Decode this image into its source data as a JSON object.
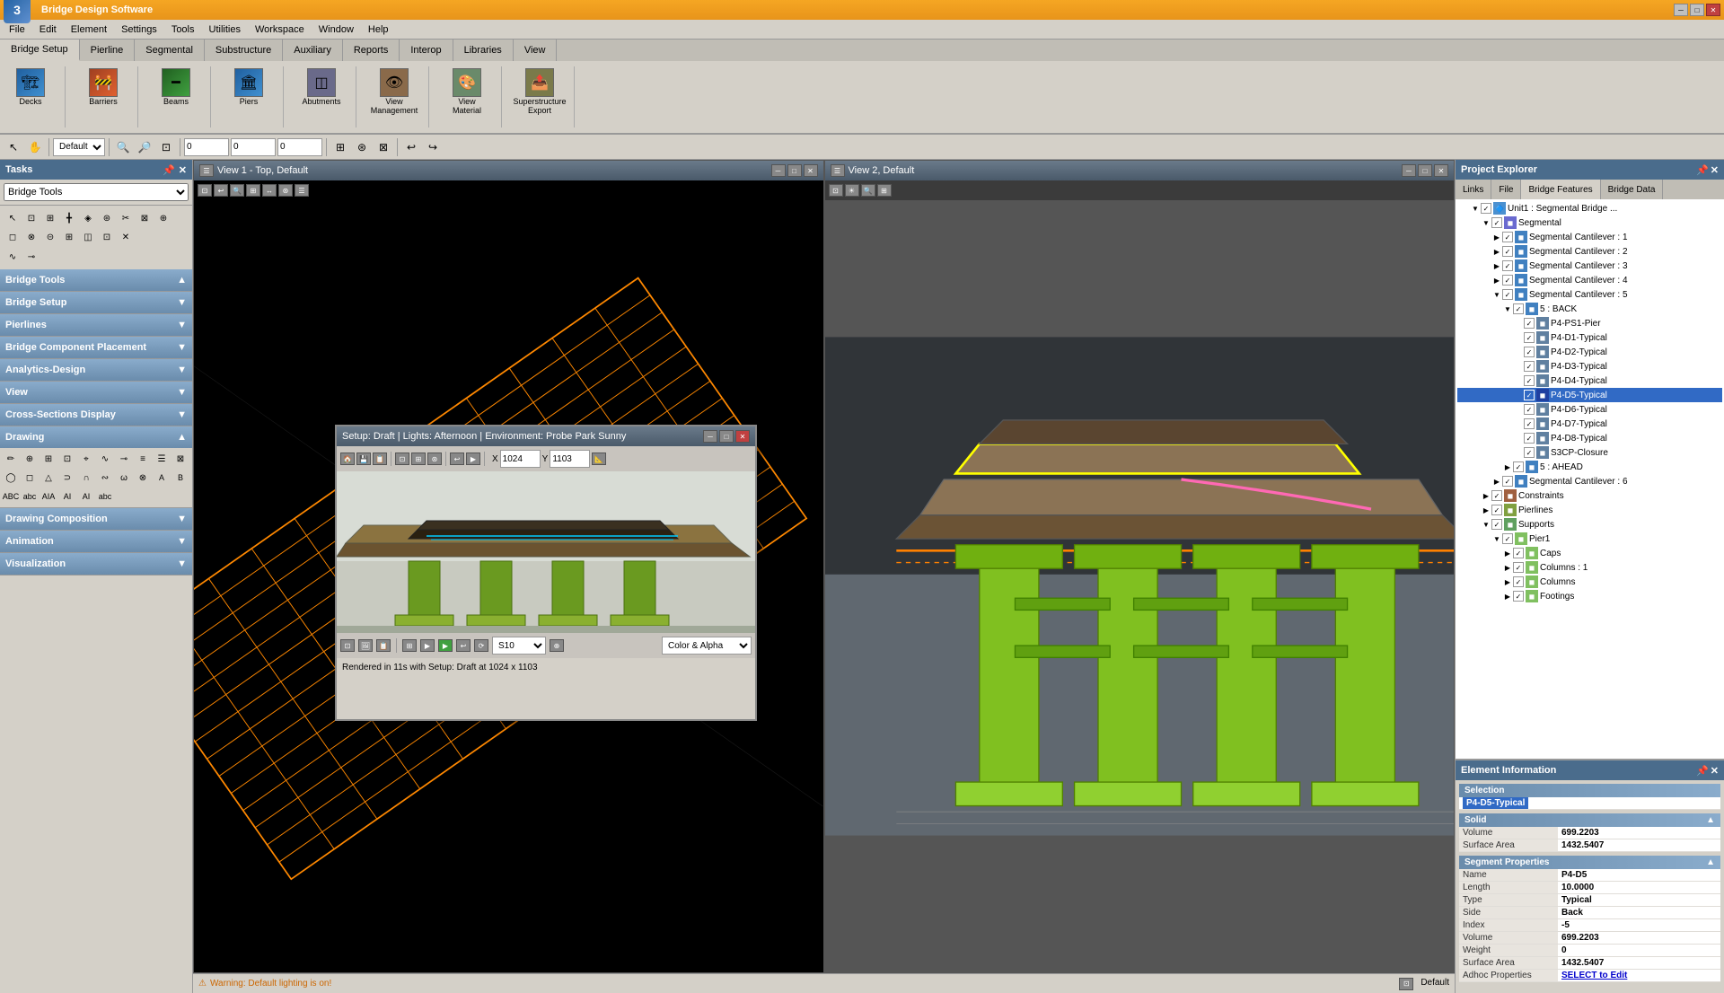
{
  "app": {
    "title": "Bridge Design Software",
    "logo": "3"
  },
  "title_bar": {
    "title": "Bridge Design",
    "minimize": "─",
    "maximize": "□",
    "close": "✕"
  },
  "menu": {
    "items": [
      "File",
      "Edit",
      "Element",
      "Settings",
      "Tools",
      "Utilities",
      "Workspace",
      "Window",
      "Help"
    ]
  },
  "ribbon": {
    "tabs": [
      "Bridge Setup",
      "Pierline",
      "Segmental",
      "Substructure",
      "Auxiliary",
      "Reports",
      "Interop",
      "Libraries",
      "View"
    ],
    "active_tab": "Bridge Setup",
    "groups": [
      {
        "name": "Decks",
        "icon": "🏗️"
      },
      {
        "name": "Barriers",
        "icon": "🚧"
      },
      {
        "name": "Beams",
        "icon": "━"
      },
      {
        "name": "Piers",
        "icon": "🏛️"
      },
      {
        "name": "Abutments",
        "icon": "◫"
      },
      {
        "name": "View Management",
        "icon": "👁️"
      },
      {
        "name": "View Material",
        "icon": "🎨"
      },
      {
        "name": "Superstructure Export",
        "icon": "📤"
      }
    ]
  },
  "tasks": {
    "title": "Tasks",
    "dropdown": "Bridge Tools",
    "sections": [
      {
        "name": "Bridge Tools",
        "expanded": true
      },
      {
        "name": "Bridge Setup",
        "expanded": false
      },
      {
        "name": "Pierlines",
        "expanded": false
      },
      {
        "name": "Bridge Component Placement",
        "expanded": false
      },
      {
        "name": "Analytics-Design",
        "expanded": false
      },
      {
        "name": "View",
        "expanded": false
      },
      {
        "name": "Cross-Sections Display",
        "expanded": false
      },
      {
        "name": "Drawing",
        "expanded": true
      }
    ],
    "sub_sections": [
      {
        "name": "Drawing Composition",
        "expanded": false
      },
      {
        "name": "Animation",
        "expanded": false
      },
      {
        "name": "Visualization",
        "expanded": false
      }
    ]
  },
  "viewports": [
    {
      "id": "view1",
      "title": "View 1 - Top, Default"
    },
    {
      "id": "view2",
      "title": "View 2, Default"
    }
  ],
  "render_window": {
    "title": "Setup: Draft | Lights: Afternoon | Environment: Probe Park Sunny",
    "coords": {
      "x_label": "X",
      "x_value": "1024",
      "y_label": "Y",
      "y_value": "1103"
    },
    "color_mode": "Color & Alpha",
    "status": "Rendered in 11s with Setup: Draft at 1024 x 1103"
  },
  "project_explorer": {
    "title": "Project Explorer",
    "tabs": [
      "Links",
      "File",
      "Bridge Features",
      "Bridge Data"
    ],
    "active_tab": "Bridge Features",
    "tree": [
      {
        "level": 0,
        "label": "Unit1 : Segmental Bridge ...",
        "expanded": true,
        "checked": true
      },
      {
        "level": 1,
        "label": "Segmental",
        "expanded": true,
        "checked": true
      },
      {
        "level": 2,
        "label": "Segmental Cantilever : 1",
        "expanded": false,
        "checked": true
      },
      {
        "level": 2,
        "label": "Segmental Cantilever : 2",
        "expanded": false,
        "checked": true
      },
      {
        "level": 2,
        "label": "Segmental Cantilever : 3",
        "expanded": false,
        "checked": true
      },
      {
        "level": 2,
        "label": "Segmental Cantilever : 4",
        "expanded": false,
        "checked": true
      },
      {
        "level": 2,
        "label": "Segmental Cantilever : 5",
        "expanded": true,
        "checked": true
      },
      {
        "level": 3,
        "label": "5 : BACK",
        "expanded": true,
        "checked": true
      },
      {
        "level": 4,
        "label": "P4-PS1-Pier",
        "expanded": false,
        "checked": true
      },
      {
        "level": 4,
        "label": "P4-D1-Typical",
        "expanded": false,
        "checked": true
      },
      {
        "level": 4,
        "label": "P4-D2-Typical",
        "expanded": false,
        "checked": true
      },
      {
        "level": 4,
        "label": "P4-D3-Typical",
        "expanded": false,
        "checked": true
      },
      {
        "level": 4,
        "label": "P4-D4-Typical",
        "expanded": false,
        "checked": true
      },
      {
        "level": 4,
        "label": "P4-D5-Typical",
        "expanded": false,
        "checked": true,
        "selected": true
      },
      {
        "level": 4,
        "label": "P4-D6-Typical",
        "expanded": false,
        "checked": true
      },
      {
        "level": 4,
        "label": "P4-D7-Typical",
        "expanded": false,
        "checked": true
      },
      {
        "level": 4,
        "label": "P4-D8-Typical",
        "expanded": false,
        "checked": true
      },
      {
        "level": 4,
        "label": "S3CP-Closure",
        "expanded": false,
        "checked": true
      },
      {
        "level": 3,
        "label": "5 : AHEAD",
        "expanded": false,
        "checked": true
      },
      {
        "level": 2,
        "label": "Segmental Cantilever : 6",
        "expanded": false,
        "checked": true
      },
      {
        "level": 1,
        "label": "Constraints",
        "expanded": false,
        "checked": true
      },
      {
        "level": 1,
        "label": "Pierlines",
        "expanded": false,
        "checked": true
      },
      {
        "level": 1,
        "label": "Supports",
        "expanded": true,
        "checked": true
      },
      {
        "level": 2,
        "label": "Pier1",
        "expanded": true,
        "checked": true
      },
      {
        "level": 3,
        "label": "Caps",
        "expanded": false,
        "checked": true
      },
      {
        "level": 3,
        "label": "Columns : 1",
        "expanded": false,
        "checked": true
      },
      {
        "level": 3,
        "label": "Columns",
        "expanded": false,
        "checked": true
      },
      {
        "level": 3,
        "label": "Footings",
        "expanded": false,
        "checked": true
      }
    ]
  },
  "element_info": {
    "title": "Element Information",
    "selection_label": "Selection",
    "selected_item": "P4-D5-Typical",
    "solid": {
      "label": "Solid",
      "volume_label": "Volume",
      "volume_value": "699.2203",
      "surface_area_label": "Surface Area",
      "surface_area_value": "1432.5407"
    },
    "segment_properties": {
      "label": "Segment Properties",
      "name_label": "Name",
      "name_value": "P4-D5",
      "length_label": "Length",
      "length_value": "10.0000",
      "type_label": "Type",
      "type_value": "Typical",
      "side_label": "Side",
      "side_value": "Back",
      "index_label": "Index",
      "index_value": "-5",
      "volume_label": "Volume",
      "volume_value": "699.2203",
      "weight_label": "Weight",
      "weight_value": "0",
      "surface_area_label": "Surface Area",
      "surface_area_value": "1432.5407",
      "adhoc_label": "Adhoc Properties",
      "adhoc_value": "SELECT to Edit"
    }
  },
  "status_bar": {
    "warning_icon": "⚠",
    "warning_text": "Warning: Default lighting is on!",
    "right_text": "Default"
  }
}
